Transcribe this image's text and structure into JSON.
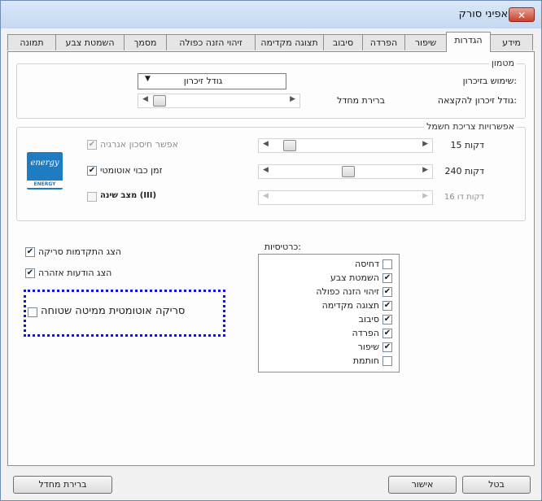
{
  "window": {
    "title": "מאפיני סורק",
    "close_label": "✕"
  },
  "tabs": [
    "מידע",
    "הגדרות",
    "שיפור",
    "הפרדה",
    "סיבוב",
    "תצוגה מקדימה",
    "זיהוי הזנה כפולה",
    "מסמך",
    "השמטת צבע",
    "תמונה"
  ],
  "active_tab": "הגדרות",
  "memory": {
    "legend": "מטמון",
    "use_label": "שימוש בזיכרון:",
    "use_value": "גודל זיכרון",
    "size_label": "גודל זיכרון להקצאה:",
    "size_value": "ברירת מחדל"
  },
  "power": {
    "legend": "אפשרויות צריכת חשמל",
    "energy_logo": {
      "script": "energy",
      "caption": "ENERGY STAR"
    },
    "rows": [
      {
        "label": "אפשר חיסכון אנרגיה",
        "checked": true,
        "enabled": false,
        "value": "15 דקות",
        "level": 0.1
      },
      {
        "label": "זמן כבוי אוטומטי",
        "checked": true,
        "enabled": true,
        "value": "240 דקות",
        "level": 0.55
      },
      {
        "label": "מצב שינה (III)",
        "checked": false,
        "enabled": false,
        "value": "16 דקות דו",
        "level": 0.0
      }
    ]
  },
  "options": {
    "show_scan_progress": {
      "label": "הצג התקדמות סריקה",
      "checked": true
    },
    "show_warnings": {
      "label": "הצג הודעות אזהרה",
      "checked": true
    },
    "auto_flatbed": {
      "label": "סריקה אוטומטית ממיטה שטוחה",
      "checked": false
    }
  },
  "tab_list": {
    "title": "כרטיסיות:",
    "items": [
      {
        "label": "דחיסה",
        "checked": false
      },
      {
        "label": "השמטת צבע",
        "checked": true
      },
      {
        "label": "זיהוי הזנה כפולה",
        "checked": true
      },
      {
        "label": "תצוגה מקדימה",
        "checked": true
      },
      {
        "label": "סיבוב",
        "checked": true
      },
      {
        "label": "הפרדה",
        "checked": true
      },
      {
        "label": "שיפור",
        "checked": true
      },
      {
        "label": "חותמת",
        "checked": false
      }
    ]
  },
  "buttons": {
    "defaults": "ברירת מחדל",
    "ok": "אישור",
    "cancel": "בטל"
  },
  "colors": {
    "highlight_border": "#1414d6",
    "close_button": "#c9412c"
  }
}
